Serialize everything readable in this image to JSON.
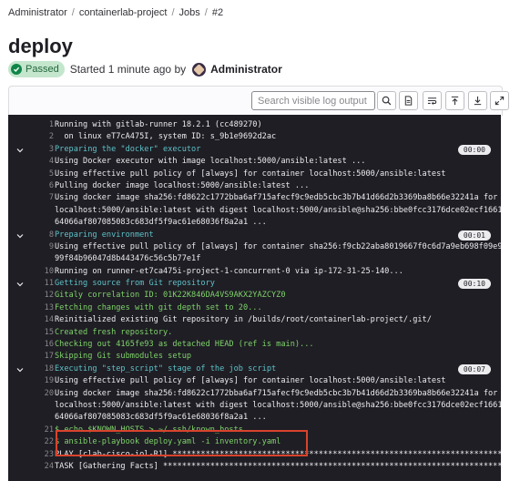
{
  "breadcrumb": [
    "Administrator",
    "containerlab-project",
    "Jobs",
    "#2"
  ],
  "page_title": "deploy",
  "status": {
    "badge": "Passed",
    "started": "Started 1 minute ago by",
    "author": "Administrator"
  },
  "toolbar": {
    "search_placeholder": "Search visible log output"
  },
  "log_lines": [
    {
      "n": "1",
      "text": "Running with gitlab-runner 18.2.1 (cc489270)",
      "color": "white",
      "chev": false,
      "dur": ""
    },
    {
      "n": "2",
      "text": "  on linux eT7cA475I, system ID: s_9b1e9692d2ac",
      "color": "white",
      "chev": false,
      "dur": ""
    },
    {
      "n": "3",
      "text": "Preparing the \"docker\" executor",
      "color": "cyan",
      "chev": true,
      "dur": "00:00"
    },
    {
      "n": "4",
      "text": "Using Docker executor with image localhost:5000/ansible:latest ...",
      "color": "white",
      "chev": false,
      "dur": ""
    },
    {
      "n": "5",
      "text": "Using effective pull policy of [always] for container localhost:5000/ansible:latest",
      "color": "white",
      "chev": false,
      "dur": ""
    },
    {
      "n": "6",
      "text": "Pulling docker image localhost:5000/ansible:latest ...",
      "color": "white",
      "chev": false,
      "dur": ""
    },
    {
      "n": "7",
      "text": "Using docker image sha256:fd8622c1772bba6af715afecf9c9edb5cbc3b7b41d66d2b3369ba8b66e32241a for",
      "color": "white",
      "chev": false,
      "dur": ""
    },
    {
      "n": "",
      "text": "localhost:5000/ansible:latest with digest localhost:5000/ansible@sha256:bbe0fcc3176dce02ecf1661",
      "color": "white",
      "chev": false,
      "dur": ""
    },
    {
      "n": "",
      "text": "64066af807085083c683df5f9ac61e68036f8a2a1 ...",
      "color": "white",
      "chev": false,
      "dur": ""
    },
    {
      "n": "8",
      "text": "Preparing environment",
      "color": "cyan",
      "chev": true,
      "dur": "00:01"
    },
    {
      "n": "9",
      "text": "Using effective pull policy of [always] for container sha256:f9cb22aba8019667f0c6d7a9eb698f09e9",
      "color": "white",
      "chev": false,
      "dur": ""
    },
    {
      "n": "",
      "text": "99f84b96047d8b443476c56c5b77e1f",
      "color": "white",
      "chev": false,
      "dur": ""
    },
    {
      "n": "10",
      "text": "Running on runner-et7ca475i-project-1-concurrent-0 via ip-172-31-25-140...",
      "color": "white",
      "chev": false,
      "dur": ""
    },
    {
      "n": "11",
      "text": "Getting source from Git repository",
      "color": "cyan",
      "chev": true,
      "dur": "00:10"
    },
    {
      "n": "12",
      "text": "Gitaly correlation ID: 01K22K846DA4VS9AKX2YAZCYZ0",
      "color": "green",
      "chev": false,
      "dur": ""
    },
    {
      "n": "13",
      "text": "Fetching changes with git depth set to 20...",
      "color": "green",
      "chev": false,
      "dur": ""
    },
    {
      "n": "14",
      "text": "Reinitialized existing Git repository in /builds/root/containerlab-project/.git/",
      "color": "white",
      "chev": false,
      "dur": ""
    },
    {
      "n": "15",
      "text": "Created fresh repository.",
      "color": "green",
      "chev": false,
      "dur": ""
    },
    {
      "n": "16",
      "text": "Checking out 4165fe93 as detached HEAD (ref is main)...",
      "color": "green",
      "chev": false,
      "dur": ""
    },
    {
      "n": "17",
      "text": "Skipping Git submodules setup",
      "color": "green",
      "chev": false,
      "dur": ""
    },
    {
      "n": "18",
      "text": "Executing \"step_script\" stage of the job script",
      "color": "cyan",
      "chev": true,
      "dur": "00:07"
    },
    {
      "n": "19",
      "text": "Using effective pull policy of [always] for container localhost:5000/ansible:latest",
      "color": "white",
      "chev": false,
      "dur": ""
    },
    {
      "n": "20",
      "text": "Using docker image sha256:fd8622c1772bba6af715afecf9c9edb5cbc3b7b41d66d2b3369ba8b66e32241a for",
      "color": "white",
      "chev": false,
      "dur": ""
    },
    {
      "n": "",
      "text": "localhost:5000/ansible:latest with digest localhost:5000/ansible@sha256:bbe0fcc3176dce02ecf1661",
      "color": "white",
      "chev": false,
      "dur": ""
    },
    {
      "n": "",
      "text": "64066af807085083c683df5f9ac61e68036f8a2a1 ...",
      "color": "white",
      "chev": false,
      "dur": ""
    },
    {
      "n": "21",
      "text": "$ echo $KNOWN_HOSTS > ~/.ssh/known_hosts",
      "color": "green",
      "chev": false,
      "dur": ""
    },
    {
      "n": "22",
      "text": "$ ansible-playbook deploy.yaml -i inventory.yaml",
      "color": "green",
      "chev": false,
      "dur": ""
    },
    {
      "n": "23",
      "text": "PLAY [clab-cisco-iol-R1] ************************************************************************",
      "color": "white",
      "chev": false,
      "dur": ""
    },
    {
      "n": "24",
      "text": "TASK [Gathering Facts] **************************************************************************",
      "color": "white",
      "chev": false,
      "dur": ""
    }
  ],
  "colors": {
    "cyan": "#5ec2c9",
    "green": "#7fd36b",
    "white": "#ececef",
    "highlight": "#d9432c"
  }
}
